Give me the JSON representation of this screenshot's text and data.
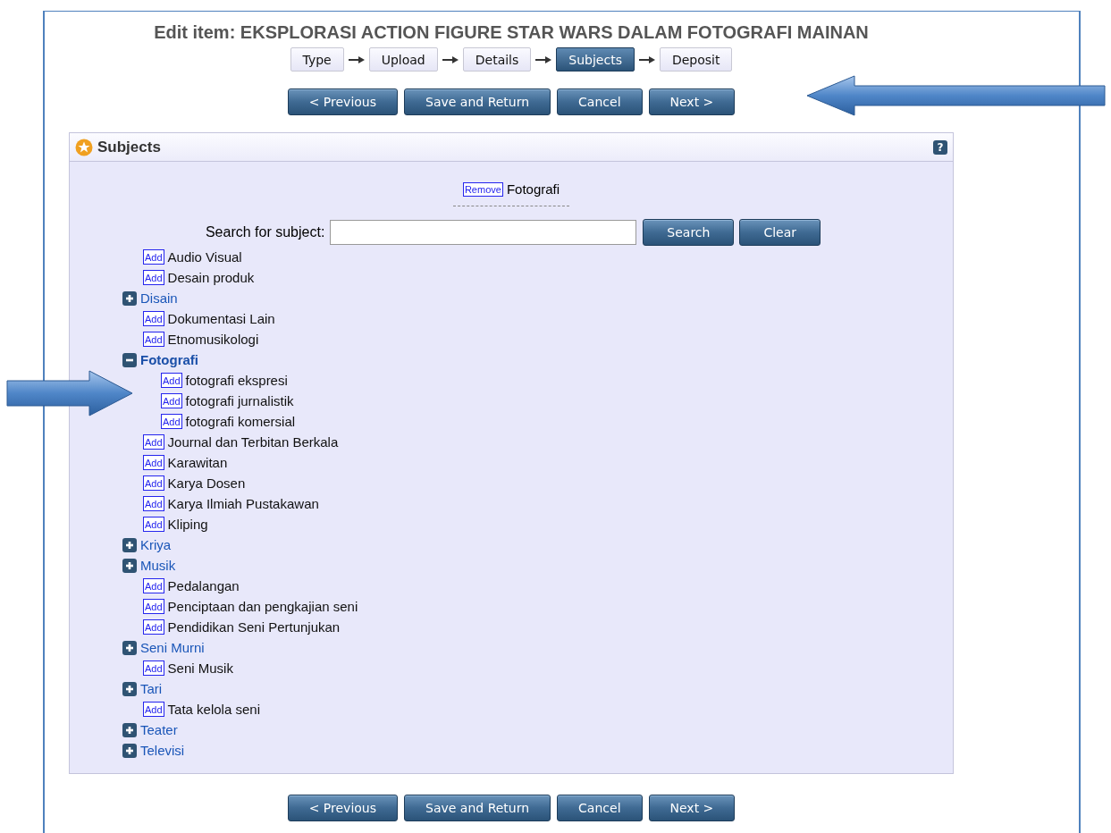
{
  "title": "Edit item: EKSPLORASI ACTION FIGURE STAR WARS DALAM FOTOGRAFI MAINAN",
  "steps": [
    {
      "label": "Type",
      "selected": false
    },
    {
      "label": "Upload",
      "selected": false
    },
    {
      "label": "Details",
      "selected": false
    },
    {
      "label": "Subjects",
      "selected": true
    },
    {
      "label": "Deposit",
      "selected": false
    }
  ],
  "top_buttons": [
    "< Previous",
    "Save and Return",
    "Cancel",
    "Next >"
  ],
  "panel": {
    "title": "Subjects",
    "help": "?",
    "selected_subjects": [
      {
        "button": "Remove",
        "label": "Fotografi"
      }
    ],
    "search": {
      "label": "Search for subject:",
      "buttons": [
        "Search",
        "Clear"
      ]
    },
    "tree": [
      {
        "kind": "leaf",
        "button": "Add",
        "label": "Audio Visual"
      },
      {
        "kind": "leaf",
        "button": "Add",
        "label": "Desain produk"
      },
      {
        "kind": "folder",
        "label": "Disain",
        "expanded": false
      },
      {
        "kind": "leaf",
        "button": "Add",
        "label": "Dokumentasi Lain"
      },
      {
        "kind": "leaf",
        "button": "Add",
        "label": "Etnomusikologi"
      },
      {
        "kind": "folder",
        "label": "Fotografi",
        "expanded": true,
        "children": [
          {
            "kind": "leaf",
            "button": "Add",
            "label": "fotografi ekspresi"
          },
          {
            "kind": "leaf",
            "button": "Add",
            "label": "fotografi jurnalistik"
          },
          {
            "kind": "leaf",
            "button": "Add",
            "label": "fotografi komersial"
          }
        ]
      },
      {
        "kind": "leaf",
        "button": "Add",
        "label": "Journal dan Terbitan Berkala"
      },
      {
        "kind": "leaf",
        "button": "Add",
        "label": "Karawitan"
      },
      {
        "kind": "leaf",
        "button": "Add",
        "label": "Karya Dosen"
      },
      {
        "kind": "leaf",
        "button": "Add",
        "label": "Karya Ilmiah Pustakawan"
      },
      {
        "kind": "leaf",
        "button": "Add",
        "label": "Kliping"
      },
      {
        "kind": "folder",
        "label": "Kriya",
        "expanded": false
      },
      {
        "kind": "folder",
        "label": "Musik",
        "expanded": false
      },
      {
        "kind": "leaf",
        "button": "Add",
        "label": "Pedalangan"
      },
      {
        "kind": "leaf",
        "button": "Add",
        "label": "Penciptaan dan pengkajian seni"
      },
      {
        "kind": "leaf",
        "button": "Add",
        "label": "Pendidikan Seni Pertunjukan"
      },
      {
        "kind": "folder",
        "label": "Seni Murni",
        "expanded": false
      },
      {
        "kind": "leaf",
        "button": "Add",
        "label": "Seni Musik"
      },
      {
        "kind": "folder",
        "label": "Tari",
        "expanded": false
      },
      {
        "kind": "leaf",
        "button": "Add",
        "label": "Tata kelola seni"
      },
      {
        "kind": "folder",
        "label": "Teater",
        "expanded": false
      },
      {
        "kind": "folder",
        "label": "Televisi",
        "expanded": false
      }
    ]
  },
  "bottom_buttons": [
    "< Previous",
    "Save and Return",
    "Cancel",
    "Next >"
  ],
  "annotations": [
    {
      "kind": "arrow_left"
    },
    {
      "kind": "arrow_right"
    }
  ]
}
